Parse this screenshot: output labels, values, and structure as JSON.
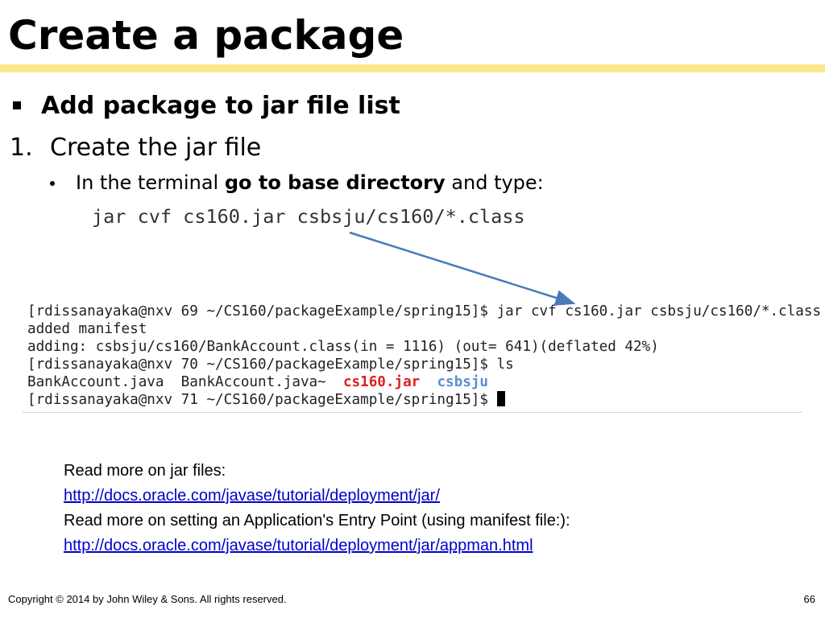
{
  "slide": {
    "title": "Create a package",
    "bullet": "Add package to jar file list",
    "numbered_item": {
      "number": "1.",
      "text": "Create the jar file"
    },
    "sub_bullet": {
      "before": "In the terminal ",
      "bold": "go to base directory",
      "after": " and type:"
    },
    "command": "jar cvf cs160.jar csbsju/cs160/*.class"
  },
  "terminal": {
    "line1": "[rdissanayaka@nxv 69 ~/CS160/packageExample/spring15]$ jar cvf cs160.jar csbsju/cs160/*.class",
    "line2": "added manifest",
    "line3": "adding: csbsju/cs160/BankAccount.class(in = 1116) (out= 641)(deflated 42%)",
    "line4": "[rdissanayaka@nxv 70 ~/CS160/packageExample/spring15]$ ls",
    "line5": {
      "file1": "BankAccount.java",
      "file2": "BankAccount.java~",
      "jar": "cs160.jar",
      "dir": "csbsju"
    },
    "line6": "[rdissanayaka@nxv 71 ~/CS160/packageExample/spring15]$ ",
    "colors": {
      "jar": "#e02020",
      "dir": "#5a8fd0"
    }
  },
  "reading": {
    "jar_label": "Read more on jar files:",
    "jar_link": "http://docs.oracle.com/javase/tutorial/deployment/jar/",
    "entry_label": "Read more on setting an Application's Entry Point (using manifest file:):",
    "entry_link": "http://docs.oracle.com/javase/tutorial/deployment/jar/appman.html"
  },
  "footer": {
    "copyright": "Copyright © 2014 by John Wiley & Sons.  All rights reserved.",
    "page_number": "66"
  },
  "colors": {
    "title_rule": "#fde78c",
    "arrow": "#4a7ab8",
    "link": "#0000cc"
  }
}
